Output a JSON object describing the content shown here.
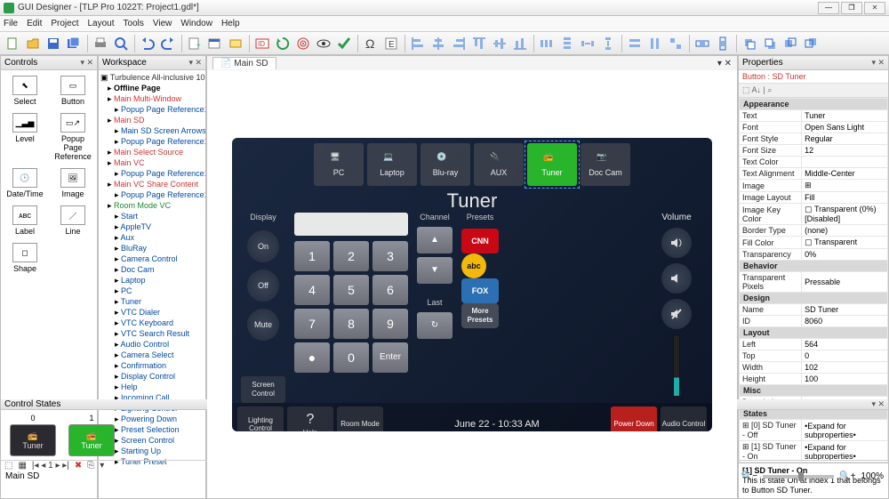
{
  "window": {
    "title": "GUI Designer - [TLP Pro 1022T: Project1.gdl*]"
  },
  "menu": [
    "File",
    "Edit",
    "Project",
    "Layout",
    "Tools",
    "View",
    "Window",
    "Help"
  ],
  "panels": {
    "controls": {
      "title": "Controls",
      "items": [
        "Select",
        "Button",
        "Level",
        "Popup Page Reference",
        "Date/Time",
        "Image",
        "Label",
        "Line",
        "Shape"
      ]
    },
    "workspace": {
      "title": "Workspace",
      "root": "Turbulence All-inclusive 1022",
      "nodes": [
        {
          "t": "Offline Page",
          "c": "tbold"
        },
        {
          "t": "Main Multi-Window",
          "c": "tred"
        },
        {
          "t": "Popup Page Reference1",
          "c": "tnode",
          "i": 1
        },
        {
          "t": "Main SD",
          "c": "tred"
        },
        {
          "t": "Main SD Screen Arrows",
          "c": "tnode",
          "i": 1
        },
        {
          "t": "Popup Page Reference1",
          "c": "tnode",
          "i": 1
        },
        {
          "t": "Main Select Source",
          "c": "tred"
        },
        {
          "t": "Main VC",
          "c": "tred"
        },
        {
          "t": "Popup Page Reference1",
          "c": "tnode",
          "i": 1
        },
        {
          "t": "Main VC Share Content",
          "c": "tred"
        },
        {
          "t": "Popup Page Reference1",
          "c": "tnode",
          "i": 1
        },
        {
          "t": "Room Mode VC",
          "c": "tgreen"
        },
        {
          "t": "Start",
          "c": "tnode",
          "i": 1
        },
        {
          "t": "AppleTV",
          "c": "tnode",
          "i": 1
        },
        {
          "t": "Aux",
          "c": "tnode",
          "i": 1
        },
        {
          "t": "BluRay",
          "c": "tnode",
          "i": 1
        },
        {
          "t": "Camera Control",
          "c": "tnode",
          "i": 1
        },
        {
          "t": "Doc Cam",
          "c": "tnode",
          "i": 1
        },
        {
          "t": "Laptop",
          "c": "tnode",
          "i": 1
        },
        {
          "t": "PC",
          "c": "tnode",
          "i": 1
        },
        {
          "t": "Tuner",
          "c": "tnode",
          "i": 1
        },
        {
          "t": "VTC Dialer",
          "c": "tnode",
          "i": 1
        },
        {
          "t": "VTC Keyboard",
          "c": "tnode",
          "i": 1
        },
        {
          "t": "VTC Search Result",
          "c": "tnode",
          "i": 1
        },
        {
          "t": "Audio Control",
          "c": "tnode",
          "i": 1
        },
        {
          "t": "Camera Select",
          "c": "tnode",
          "i": 1
        },
        {
          "t": "Confirmation",
          "c": "tnode",
          "i": 1
        },
        {
          "t": "Display Control",
          "c": "tnode",
          "i": 1
        },
        {
          "t": "Help",
          "c": "tnode",
          "i": 1
        },
        {
          "t": "Incoming Call",
          "c": "tnode",
          "i": 1
        },
        {
          "t": "Lighting Control",
          "c": "tnode",
          "i": 1
        },
        {
          "t": "Powering Down",
          "c": "tnode",
          "i": 1
        },
        {
          "t": "Preset Selection",
          "c": "tnode",
          "i": 1
        },
        {
          "t": "Screen Control",
          "c": "tnode",
          "i": 1
        },
        {
          "t": "Starting Up",
          "c": "tnode",
          "i": 1
        },
        {
          "t": "Tuner Preset",
          "c": "tnode",
          "i": 1
        }
      ]
    },
    "canvas": {
      "tab": "Main SD"
    },
    "properties": {
      "title": "Properties",
      "object": "Button : SD Tuner",
      "rows": [
        {
          "cat": "Appearance"
        },
        {
          "k": "Text",
          "v": "Tuner"
        },
        {
          "k": "Font",
          "v": "Open Sans Light"
        },
        {
          "k": "Font Style",
          "v": "Regular"
        },
        {
          "k": "Font Size",
          "v": "12"
        },
        {
          "k": "Text Color",
          "v": ""
        },
        {
          "k": "Text Alignment",
          "v": "Middle-Center"
        },
        {
          "k": "Image",
          "v": "⊞"
        },
        {
          "k": "Image Layout",
          "v": "Fill"
        },
        {
          "k": "Image Key Color",
          "v": "▢ Transparent (0%) [Disabled]"
        },
        {
          "k": "Border Type",
          "v": "(none)"
        },
        {
          "k": "Fill Color",
          "v": "▢   Transparent"
        },
        {
          "k": "Transparency",
          "v": "0%"
        },
        {
          "cat": "Behavior"
        },
        {
          "k": "Transparent Pixels",
          "v": "Pressable"
        },
        {
          "cat": "Design"
        },
        {
          "k": "Name",
          "v": "SD Tuner"
        },
        {
          "k": "ID",
          "v": "8060"
        },
        {
          "cat": "Layout"
        },
        {
          "k": "Left",
          "v": "564"
        },
        {
          "k": "Top",
          "v": "0"
        },
        {
          "k": "Width",
          "v": "102"
        },
        {
          "k": "Height",
          "v": "100"
        },
        {
          "cat": "Misc"
        },
        {
          "k": "Description",
          "v": ""
        },
        {
          "cat": "States"
        },
        {
          "k": "⊞ [0] SD Tuner - Off",
          "v": "•Expand for subproperties•"
        },
        {
          "k": "⊞ [1] SD Tuner - On",
          "v": "•Expand for subproperties•"
        }
      ],
      "selected": {
        "title": "[1] SD Tuner - On",
        "desc": "This is state On at index 1 that belongs to Button SD Tuner."
      }
    },
    "states": {
      "title": "Control States",
      "items": [
        {
          "idx": "0",
          "label": "Tuner",
          "cls": "off"
        },
        {
          "idx": "1",
          "label": "Tuner",
          "cls": "on"
        }
      ]
    }
  },
  "device": {
    "sources": [
      "PC",
      "Laptop",
      "Blu-ray",
      "AUX",
      "Tuner",
      "Doc Cam"
    ],
    "active_source_index": 4,
    "title": "Tuner",
    "left_label": "Display",
    "left_buttons": [
      "On",
      "Off",
      "Mute"
    ],
    "screen_control": "Screen Control",
    "keypad": [
      "1",
      "2",
      "3",
      "4",
      "5",
      "6",
      "7",
      "8",
      "9",
      "●",
      "0",
      "Enter"
    ],
    "channel_label": "Channel",
    "last_label": "Last",
    "presets_label": "Presets",
    "presets": [
      {
        "txt": "CNN",
        "cls": "cnn"
      },
      {
        "txt": "abc",
        "cls": "abc"
      },
      {
        "txt": "FOX",
        "cls": "fox"
      },
      {
        "txt": "More Presets",
        "cls": "more"
      }
    ],
    "volume_label": "Volume",
    "bottom": {
      "lighting": "Lighting Control",
      "help": "Help",
      "room": "Room Mode",
      "time": "June 22 - 10:33 AM",
      "power": "Power Down",
      "audio": "Audio Control"
    }
  },
  "status": {
    "page": "Main SD",
    "zoom": "100%"
  }
}
